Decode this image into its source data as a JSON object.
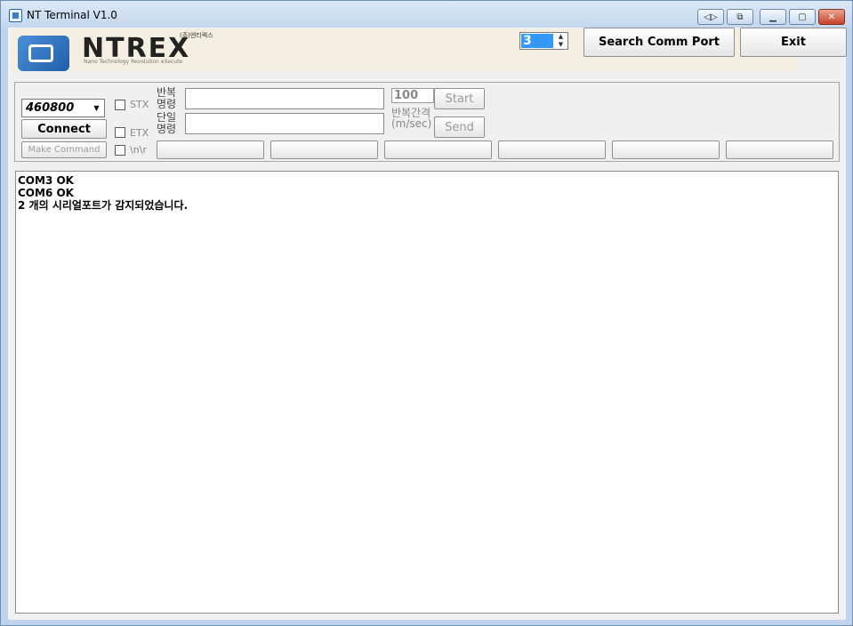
{
  "window": {
    "title": "NT Terminal V1.0",
    "caption_buttons": [
      "restore-size-icon",
      "sync-icon",
      "minimize-icon",
      "maximize-icon",
      "close-icon"
    ]
  },
  "logo": {
    "text": "NTREX",
    "korean": "(주)엔티렉스",
    "tagline": "Nano Technology Revolution eXecute"
  },
  "port_count": {
    "value": "3"
  },
  "buttons": {
    "search": "Search Comm Port",
    "exit": "Exit",
    "connect": "Connect",
    "make_command": "Make Command",
    "start": "Start",
    "send": "Send"
  },
  "serial": {
    "baud_rate": "460800",
    "stx_label": "STX",
    "etx_label": "ETX",
    "nr_label": "\\n\\r",
    "repeat_cmd_label": [
      "반복",
      "명령"
    ],
    "single_cmd_label": [
      "단일",
      "명령"
    ],
    "interval_value": "100",
    "interval_label": "반복간격",
    "interval_unit": "(m/sec)",
    "repeat_cmd_value": "",
    "single_cmd_value": ""
  },
  "macro_buttons": [
    "",
    "",
    "",
    "",
    "",
    ""
  ],
  "output_lines": [
    "COM3 OK",
    "COM6 OK",
    "2 개의 시리얼포트가 감지되었습니다."
  ],
  "colors": {
    "selection": "#3399ff",
    "logo_band": "#f4efe0",
    "window_frame": "#bdd3ee"
  }
}
